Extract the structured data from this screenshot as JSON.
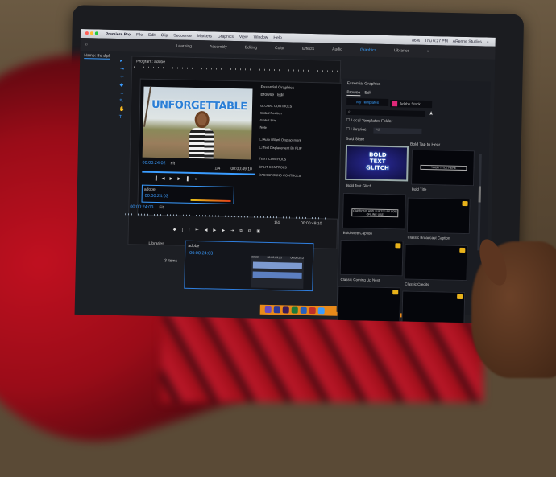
{
  "menubar": {
    "app": "Premiere Pro",
    "items": [
      "File",
      "Edit",
      "Clip",
      "Sequence",
      "Markers",
      "Graphics",
      "View",
      "Window",
      "Help"
    ],
    "clock": "Thu 6:27 PM",
    "user": "ARenne Studios",
    "battery": "86%"
  },
  "workspaces": {
    "tabs": [
      "Learning",
      "Assembly",
      "Editing",
      "Color",
      "Effects",
      "Audio",
      "Graphics",
      "Libraries"
    ],
    "active": "Graphics",
    "more": "»"
  },
  "source_panel": {
    "title": "Name: Bo-dipl"
  },
  "program": {
    "title": "Program: adobe",
    "video_title": "UNFORGETTABLE",
    "timecode": "00:00:24:02",
    "fit": "Fit",
    "resolution": "1/4",
    "duration": "00:00:49:10"
  },
  "inner_eg": {
    "title": "Essential Graphics",
    "tabs": [
      "Browse",
      "Edit"
    ],
    "sections": [
      "GLOBAL CONTROLS",
      "Global Position",
      "Global Size",
      "Note"
    ],
    "checks": [
      "Auto / Blank Displacement",
      "Text Displacement By FLIP"
    ],
    "groups": [
      "TEXT CONTROLS",
      "SPLIT CONTROLS",
      "BACKGROUND CONTROLS"
    ]
  },
  "inner_timeline": {
    "name": "adobe",
    "timecode": "00:00:24:03",
    "outer_timecode": "00:00:24:03",
    "fit": "Fit"
  },
  "essential_graphics": {
    "title": "Essential Graphics",
    "tabs": [
      "Browse",
      "Edit"
    ],
    "source_tabs": [
      "My Templates",
      "Adobe Stock"
    ],
    "local_folder": "Local Templates Folder",
    "libraries": "Libraries",
    "libraries_value": "All",
    "templates": [
      {
        "name": "Bold Text Glitch",
        "group": "Bold Slate",
        "preview": "BOLD TEXT GLITCH",
        "selected": true
      },
      {
        "name": "Bold Title",
        "group": "Bold Tap to Hear",
        "preview": "YOUR TITLE HERE"
      },
      {
        "name": "Bold Web Caption",
        "preview": "CAPTIONS AND SUBTITLES FOR ONLINE USE"
      },
      {
        "name": "Classic Broadcast Caption",
        "premium": true
      },
      {
        "name": "Classic Coming Up Next",
        "premium": true
      },
      {
        "name": "Classic Credits",
        "premium": true
      },
      {
        "name": "",
        "premium": true
      },
      {
        "name": "",
        "premium": true
      }
    ]
  },
  "bottom": {
    "libraries": "Libraries",
    "items": "3 items",
    "sequence": "adobe",
    "timecode": "00:00:24:03",
    "ruler": [
      "00:00",
      "00:00:09:23",
      "00:00:24:2"
    ]
  },
  "colors": {
    "accent": "#3a9cff",
    "premium_badge": "#e8b21a",
    "shirt": "#b01020",
    "dock": "#e98a1a"
  }
}
